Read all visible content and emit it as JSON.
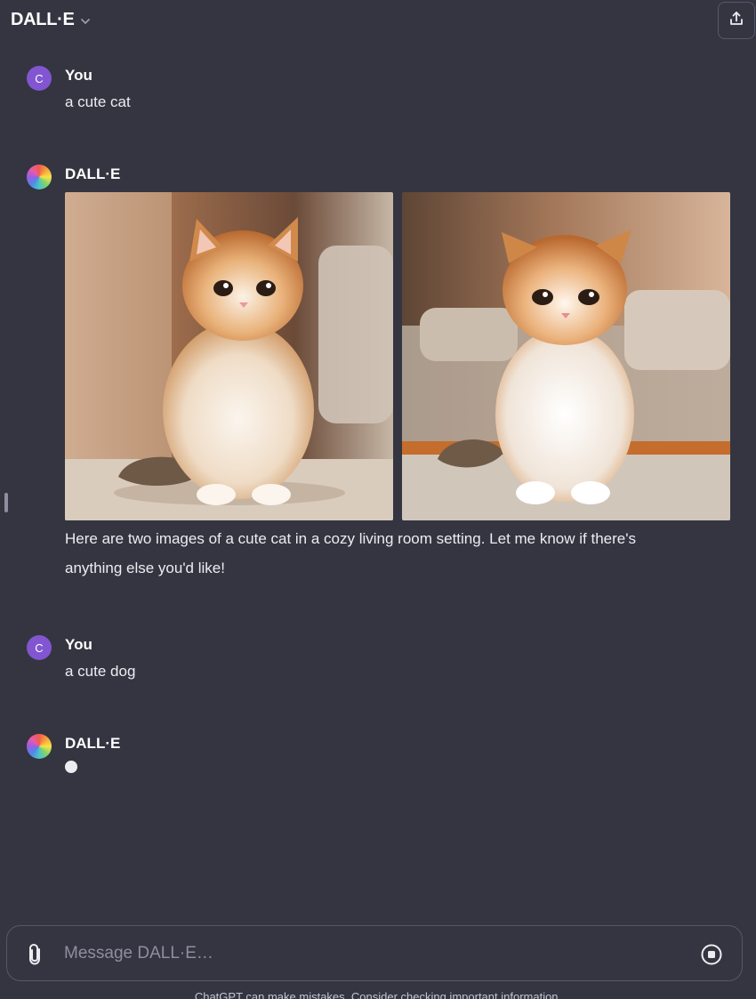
{
  "header": {
    "title": "DALL·E"
  },
  "messages": [
    {
      "sender": "You",
      "avatar_letter": "C",
      "text": "a cute cat"
    },
    {
      "sender": "DALL·E",
      "images": [
        {
          "description": "orange and white kitten sitting on a rug in a warmly lit room"
        },
        {
          "description": "orange and white kitten sitting in front of a sofa"
        }
      ],
      "text_line1": "Here are two images of a cute cat in a cozy living room setting. Let me know if there's",
      "text_line2": "anything else you'd like!"
    },
    {
      "sender": "You",
      "avatar_letter": "C",
      "text": "a cute dog"
    },
    {
      "sender": "DALL·E",
      "status": "generating"
    }
  ],
  "composer": {
    "placeholder": "Message DALL·E…"
  },
  "footer": {
    "disclaimer": "ChatGPT can make mistakes. Consider checking important information."
  },
  "colors": {
    "background": "#343541",
    "user_avatar": "#8156d0",
    "text": "#ececf1",
    "border": "#565869"
  }
}
